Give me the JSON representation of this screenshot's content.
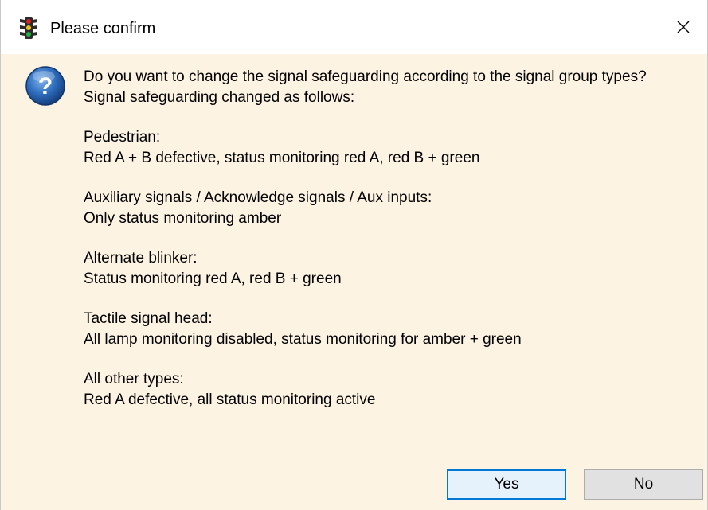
{
  "window": {
    "title": "Please confirm",
    "close_glyph": "✕",
    "title_icon": "traffic-light-icon"
  },
  "dialog": {
    "icon": "question-icon",
    "question": "Do you want to change the signal safeguarding according to the signal group types?",
    "intro": "Signal safeguarding changed as follows:",
    "groups": [
      {
        "heading": "Pedestrian:",
        "detail": "Red A + B defective, status monitoring red A, red B + green"
      },
      {
        "heading": "Auxiliary signals / Acknowledge signals / Aux inputs:",
        "detail": "Only status monitoring amber"
      },
      {
        "heading": "Alternate blinker:",
        "detail": "Status monitoring red A, red B + green"
      },
      {
        "heading": "Tactile signal head:",
        "detail": "All lamp monitoring disabled, status monitoring for amber + green"
      },
      {
        "heading": "All other types:",
        "detail": "Red A defective, all status monitoring active"
      }
    ]
  },
  "buttons": {
    "yes_label": "Yes",
    "no_label": "No"
  },
  "colors": {
    "background": "#fdf3e3",
    "titlebar": "#ffffff",
    "accent_border": "#0078d7",
    "question_icon": "#2a6fb5"
  }
}
